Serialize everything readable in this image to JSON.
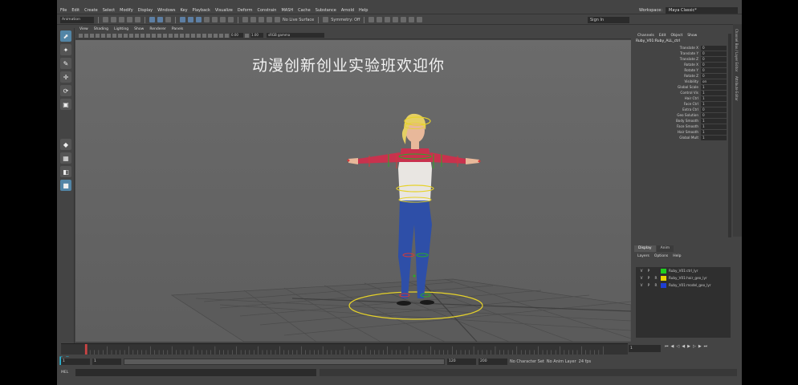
{
  "menubar": {
    "items": [
      "File",
      "Edit",
      "Create",
      "Select",
      "Modify",
      "Display",
      "Windows",
      "Key",
      "Playback",
      "Visualize",
      "Deform",
      "Constrain",
      "MASH",
      "Cache",
      "Substance",
      "Arnold",
      "Help"
    ],
    "workspace_label": "Workspace:",
    "workspace_value": "Maya Classic*"
  },
  "statusline": {
    "mode_menu": "Animation",
    "live_surface": "No Live Surface",
    "symmetry": "Symmetry: Off",
    "sign_in": "Sign In"
  },
  "panel": {
    "menu": [
      "View",
      "Shading",
      "Lighting",
      "Show",
      "Renderer",
      "Panels"
    ],
    "field_a": "0.00",
    "field_b": "1.00",
    "color_space": "sRGB gamma"
  },
  "viewport": {
    "overlay_text": "动漫创新创业实验班欢迎你"
  },
  "channel_box": {
    "menu": [
      "Channels",
      "Edit",
      "Object",
      "Show"
    ],
    "object_name": "Ruby_V01:Ruby_ALL_ctrl",
    "attributes": [
      {
        "name": "Translate X",
        "value": "0"
      },
      {
        "name": "Translate Y",
        "value": "0"
      },
      {
        "name": "Translate Z",
        "value": "0"
      },
      {
        "name": "Rotate X",
        "value": "0"
      },
      {
        "name": "Rotate Y",
        "value": "0"
      },
      {
        "name": "Rotate Z",
        "value": "0"
      },
      {
        "name": "Visibility",
        "value": "on"
      },
      {
        "name": "Global Scale",
        "value": "1"
      },
      {
        "name": "Control Vis",
        "value": "1"
      },
      {
        "name": "Hair Ctrl",
        "value": "1"
      },
      {
        "name": "Face Ctrl",
        "value": "1"
      },
      {
        "name": "Extra Ctrl",
        "value": "0"
      },
      {
        "name": "Geo Solution",
        "value": "0"
      },
      {
        "name": "Body Smooth",
        "value": "1"
      },
      {
        "name": "Face Smooth",
        "value": "1"
      },
      {
        "name": "Hair Smooth",
        "value": "1"
      },
      {
        "name": "Global Mult",
        "value": "1"
      }
    ]
  },
  "side_tabs": [
    "Channel Box / Layer Editor",
    "Attribute Editor"
  ],
  "layer_editor": {
    "tabs": [
      "Display",
      "Anim"
    ],
    "menu": [
      "Layers",
      "Options",
      "Help"
    ],
    "layers": [
      {
        "v": "V",
        "p": "P",
        "r": "",
        "name": "Ruby_V01:ctrl_lyr",
        "color": "#1fcf1f"
      },
      {
        "v": "V",
        "p": "P",
        "r": "R",
        "name": "Ruby_V01:hair_geo_lyr",
        "color": "#e8d400"
      },
      {
        "v": "V",
        "p": "P",
        "r": "R",
        "name": "Ruby_V01:model_geo_lyr",
        "color": "#1f3fd4"
      }
    ]
  },
  "time": {
    "current_frame": "1",
    "range_start": "1",
    "range_start_inner": "1",
    "range_end_inner": "120",
    "range_end": "120",
    "anim_end": "200",
    "character_set": "No Character Set",
    "anim_layer": "No Anim Layer",
    "fps": "24 fps"
  },
  "cmdline": {
    "label": "MEL"
  },
  "colors": {
    "accent": "#5285a6",
    "maya_logo": "#29b6d6"
  }
}
